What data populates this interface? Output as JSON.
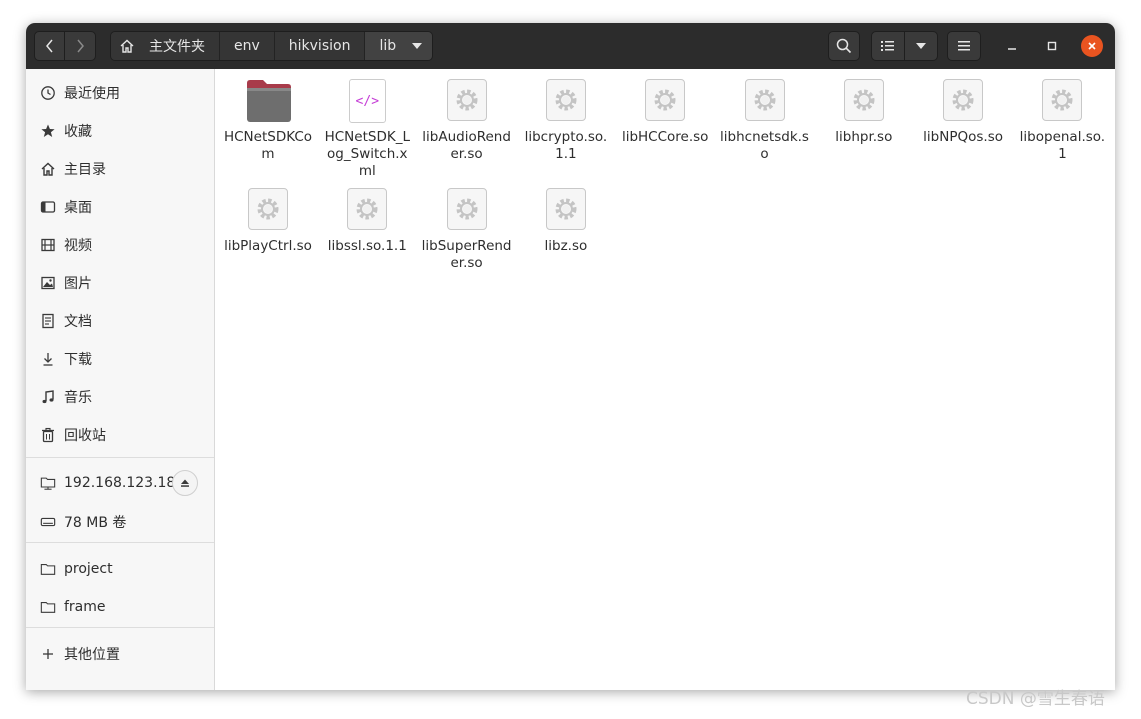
{
  "header": {
    "breadcrumbs": [
      {
        "label": "主文件夹",
        "icon": "home-icon"
      },
      {
        "label": "env"
      },
      {
        "label": "hikvision"
      },
      {
        "label": "lib",
        "current": true
      }
    ]
  },
  "sidebar": {
    "places": [
      {
        "label": "最近使用",
        "icon": "recent-icon"
      },
      {
        "label": "收藏",
        "icon": "star-icon"
      },
      {
        "label": "主目录",
        "icon": "home-icon"
      },
      {
        "label": "桌面",
        "icon": "desktop-icon"
      },
      {
        "label": "视频",
        "icon": "video-icon"
      },
      {
        "label": "图片",
        "icon": "picture-icon"
      },
      {
        "label": "文档",
        "icon": "document-icon"
      },
      {
        "label": "下载",
        "icon": "download-icon"
      },
      {
        "label": "音乐",
        "icon": "music-icon"
      },
      {
        "label": "回收站",
        "icon": "trash-icon"
      }
    ],
    "devices": [
      {
        "label": "192.168.123.18",
        "icon": "network-drive-icon",
        "ejectable": true
      },
      {
        "label": "78 MB 卷",
        "icon": "drive-icon"
      }
    ],
    "bookmarks": [
      {
        "label": "project",
        "icon": "folder-icon"
      },
      {
        "label": "frame",
        "icon": "folder-icon"
      }
    ],
    "other": {
      "label": "其他位置",
      "icon": "plus-icon"
    }
  },
  "files": [
    {
      "name": "HCNetSDKCom",
      "type": "folder"
    },
    {
      "name": "HCNetSDK_Log_Switch.xml",
      "type": "xml"
    },
    {
      "name": "libAudioRender.so",
      "type": "library"
    },
    {
      "name": "libcrypto.so.1.1",
      "type": "library"
    },
    {
      "name": "libHCCore.so",
      "type": "library"
    },
    {
      "name": "libhcnetsdk.so",
      "type": "library"
    },
    {
      "name": "libhpr.so",
      "type": "library"
    },
    {
      "name": "libNPQos.so",
      "type": "library"
    },
    {
      "name": "libopenal.so.1",
      "type": "library"
    },
    {
      "name": "libPlayCtrl.so",
      "type": "library"
    },
    {
      "name": "libssl.so.1.1",
      "type": "library"
    },
    {
      "name": "libSuperRender.so",
      "type": "library"
    },
    {
      "name": "libz.so",
      "type": "library"
    }
  ],
  "watermark": "CSDN @雪生春语",
  "colors": {
    "headerbar": "#2c2c2c",
    "close_button": "#e95420",
    "folder_tab": "#a83b4a",
    "folder_body": "#6e6e6e",
    "xml_code": "#c53fd6"
  }
}
